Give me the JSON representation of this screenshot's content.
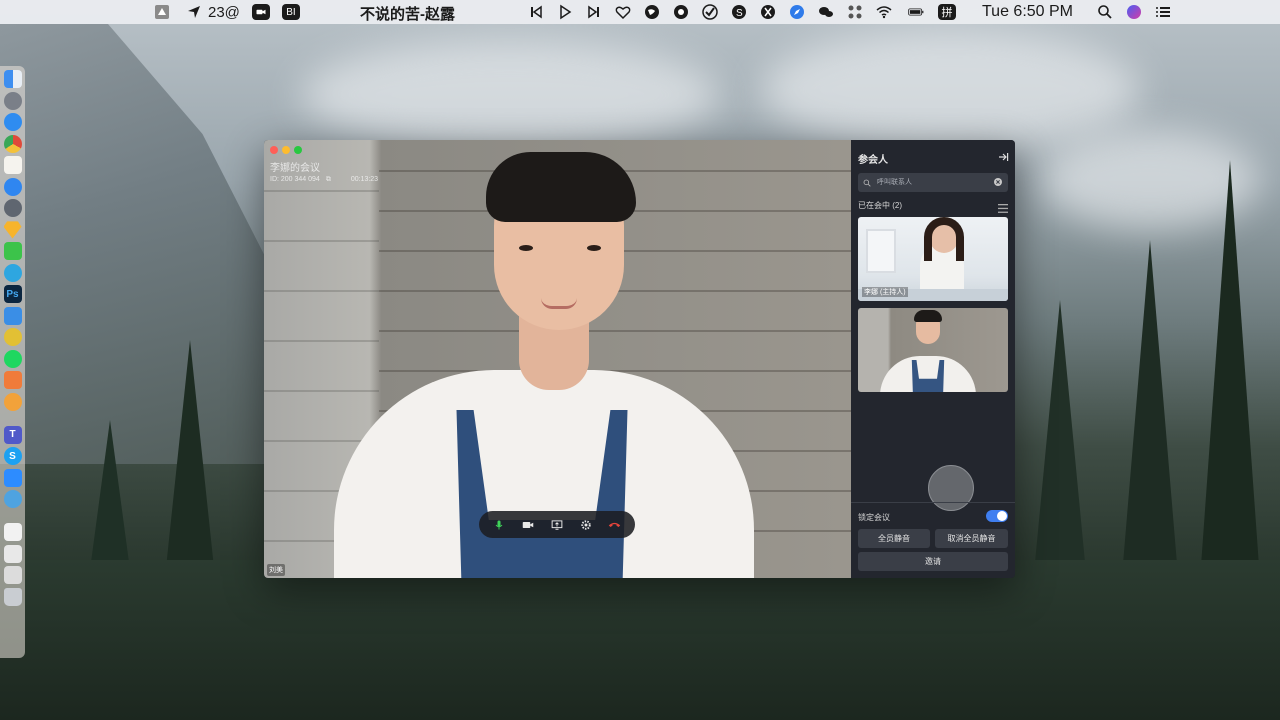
{
  "menubar": {
    "notification_count": "23@",
    "now_playing": "不说的苦-赵露",
    "clock": "Tue 6:50 PM",
    "icons": [
      "finder-icon",
      "location-icon",
      "zoom-icon",
      "bi-icon",
      "prev-track-icon",
      "play-icon",
      "next-track-icon",
      "heart-icon",
      "globe-icon",
      "app-icon",
      "check-icon",
      "skype-icon",
      "app2-icon",
      "compass-icon",
      "wechat-icon",
      "control-icon",
      "wifi-icon",
      "battery-icon",
      "input-method-icon",
      "search-icon",
      "siri-icon",
      "menu-icon"
    ],
    "input_method_label": "拼"
  },
  "dock": {
    "items": [
      "finder",
      "launchpad",
      "safari",
      "chrome",
      "notes",
      "appstore",
      "system-preferences",
      "sketch",
      "wechat",
      "telegram",
      "photoshop",
      "qq",
      "slack",
      "spotify",
      "script-editor",
      "vpn",
      "teams",
      "skype",
      "zoom",
      "safari2",
      "document",
      "notepad",
      "preview",
      "trash"
    ],
    "ps_label": "Ps",
    "teams_label": "T",
    "skype_label": "S"
  },
  "meeting": {
    "title": "李娜的会议",
    "meeting_id": "ID: 200 344 094",
    "duration": "00:13:23",
    "speaker_name": "刘美"
  },
  "panel": {
    "title": "参会人",
    "search_placeholder": "呼叫联系人",
    "in_meeting_label": "已在会中 (2)",
    "participants": [
      {
        "name": "李娜 (主持人)"
      },
      {
        "name": ""
      }
    ],
    "lock_label": "锁定会议",
    "lock_on": true,
    "mute_all": "全员静音",
    "unmute_all": "取消全员静音",
    "invite": "邀请"
  },
  "colors": {
    "accent": "#3f7ef0",
    "hangup": "#e5443b",
    "panel_bg": "#23262e"
  }
}
